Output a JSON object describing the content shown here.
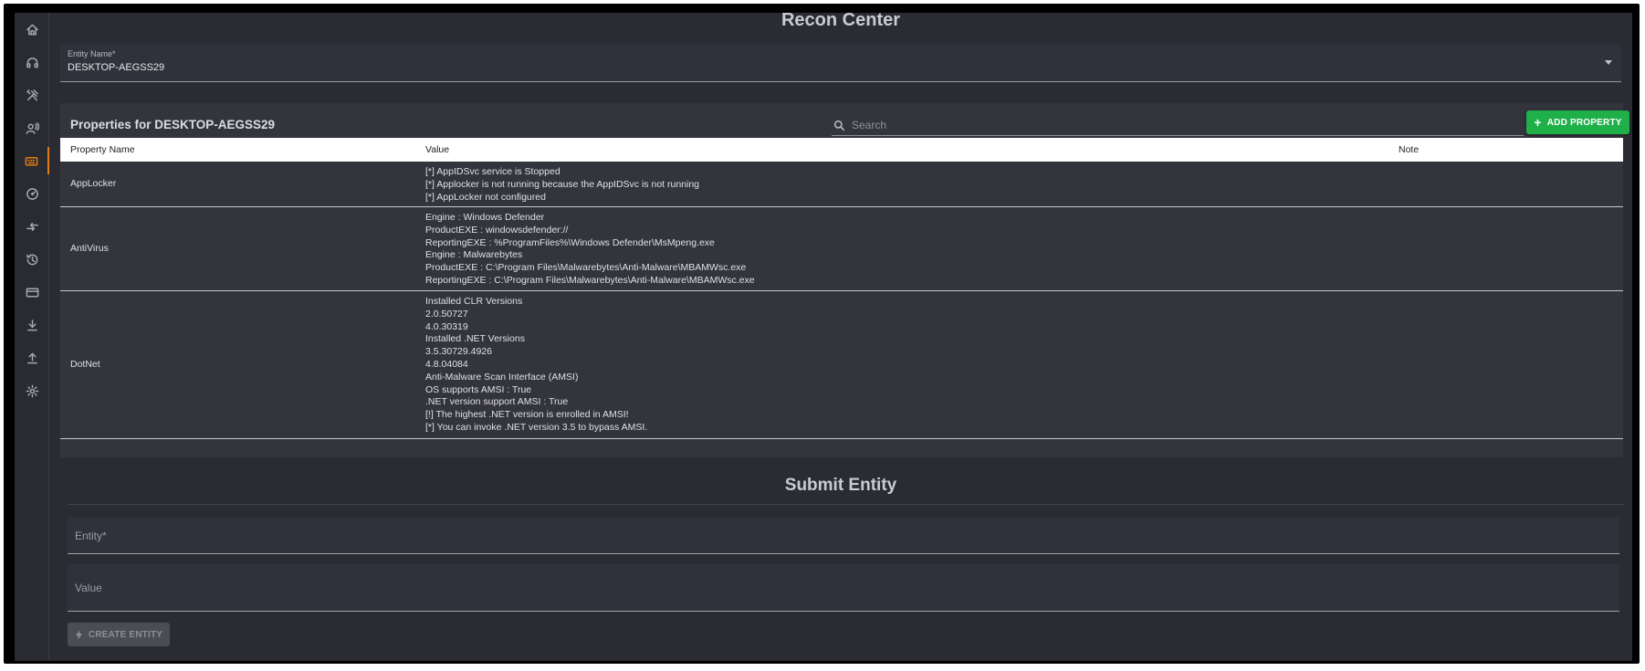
{
  "header": {
    "title": "Recon Center"
  },
  "entity_select": {
    "label": "Entity Name*",
    "value": "DESKTOP-AEGSS29"
  },
  "properties": {
    "title": "Properties for DESKTOP-AEGSS29",
    "search_placeholder": "Search",
    "add_button_label": "ADD PROPERTY",
    "columns": {
      "name": "Property Name",
      "value": "Value",
      "note": "Note"
    },
    "rows": [
      {
        "name": "AppLocker",
        "value": "[*] AppIDSvc service is Stopped\n[*] Applocker is not running because the AppIDSvc is not running\n[*] AppLocker not configured",
        "note": ""
      },
      {
        "name": "AntiVirus",
        "value": "Engine : Windows Defender\nProductEXE : windowsdefender://\nReportingEXE : %ProgramFiles%\\Windows Defender\\MsMpeng.exe\nEngine : Malwarebytes\nProductEXE : C:\\Program Files\\Malwarebytes\\Anti-Malware\\MBAMWsc.exe\nReportingEXE : C:\\Program Files\\Malwarebytes\\Anti-Malware\\MBAMWsc.exe",
        "note": ""
      },
      {
        "name": "DotNet",
        "value": "Installed CLR Versions\n2.0.50727\n4.0.30319\nInstalled .NET Versions\n3.5.30729.4926\n4.8.04084\nAnti-Malware Scan Interface (AMSI)\nOS supports AMSI : True\n.NET version support AMSI : True\n[!] The highest .NET version is enrolled in AMSI!\n[*] You can invoke .NET version 3.5 to bypass AMSI.",
        "note": ""
      }
    ]
  },
  "submit": {
    "title": "Submit Entity",
    "entity_placeholder": "Entity*",
    "value_placeholder": "Value",
    "create_button_label": "CREATE ENTITY"
  },
  "sidebar": {
    "items": [
      {
        "icon": "home-icon"
      },
      {
        "icon": "headphones-icon"
      },
      {
        "icon": "tools-icon"
      },
      {
        "icon": "user-voice-icon"
      },
      {
        "icon": "keyboard-icon",
        "active": true
      },
      {
        "icon": "speed-icon"
      },
      {
        "icon": "swap-icon"
      },
      {
        "icon": "history-icon"
      },
      {
        "icon": "credit-card-icon"
      },
      {
        "icon": "download-icon"
      },
      {
        "icon": "upload-icon"
      },
      {
        "icon": "settings-icon"
      }
    ]
  },
  "colors": {
    "accent": "#e07b1a",
    "add_button": "#1fb04a",
    "background": "#2b2c33"
  }
}
